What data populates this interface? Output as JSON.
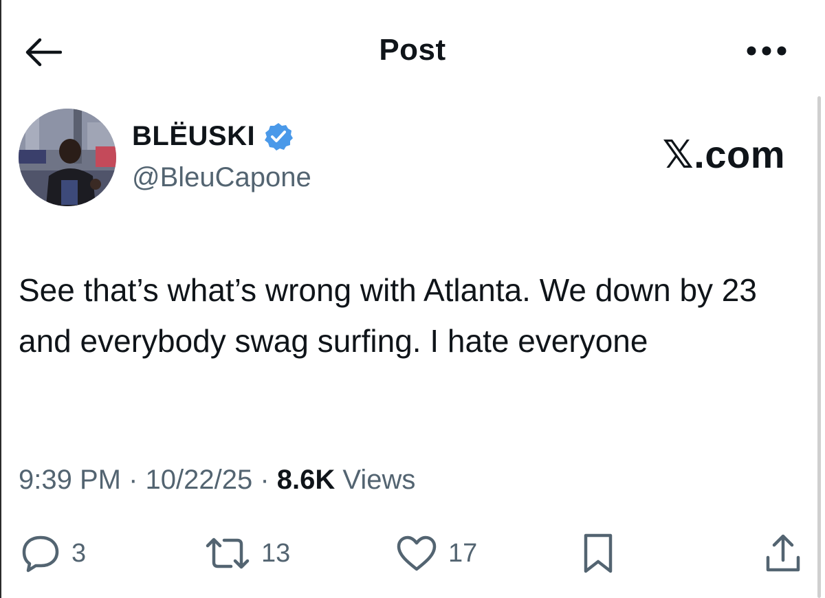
{
  "header": {
    "title": "Post",
    "back_icon": "arrow-left-icon",
    "more_icon": "more-horizontal-icon"
  },
  "author": {
    "display_name": "BLËUSKI",
    "handle": "@BleuCapone",
    "verified_color": "#4a99e9"
  },
  "watermark": "𝕏.com",
  "tweet": {
    "text": "See that’s what’s wrong with Atlanta. We down by 23 and everybody swag surfing. I hate everyone",
    "time": "9:39 PM",
    "date": "10/22/25",
    "views_count": "8.6K",
    "views_label": "Views"
  },
  "actions": {
    "replies": "3",
    "reposts": "13",
    "likes": "17"
  },
  "colors": {
    "text_primary": "#0f1419",
    "text_secondary": "#536471",
    "verified_blue": "#4a99e9"
  }
}
